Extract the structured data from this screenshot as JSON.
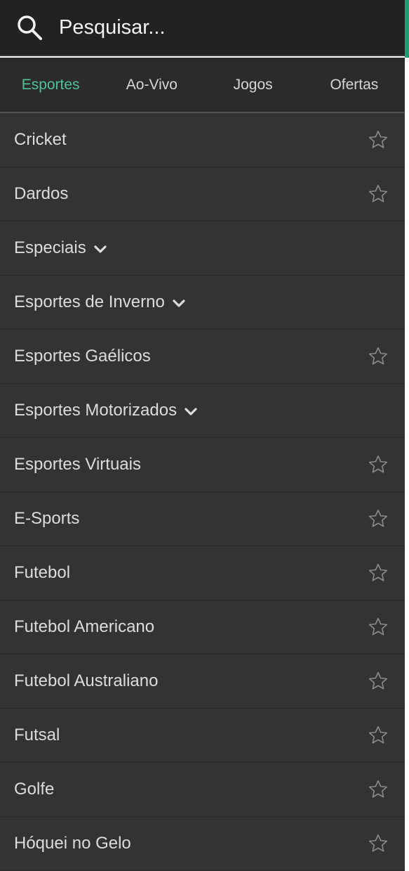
{
  "search": {
    "placeholder": "Pesquisar...",
    "icon": "search-icon"
  },
  "colors": {
    "accent": "#4fc295",
    "header_bg": "#222222",
    "list_bg": "#333333"
  },
  "tabs": [
    {
      "label": "Esportes",
      "active": true
    },
    {
      "label": "Ao-Vivo",
      "active": false
    },
    {
      "label": "Jogos",
      "active": false
    },
    {
      "label": "Ofertas",
      "active": false
    }
  ],
  "sports": [
    {
      "label": "Cricket",
      "action": "star"
    },
    {
      "label": "Dardos",
      "action": "star"
    },
    {
      "label": "Especiais",
      "action": "expand"
    },
    {
      "label": "Esportes de Inverno",
      "action": "expand"
    },
    {
      "label": "Esportes Gaélicos",
      "action": "star"
    },
    {
      "label": "Esportes Motorizados",
      "action": "expand"
    },
    {
      "label": "Esportes Virtuais",
      "action": "star"
    },
    {
      "label": "E-Sports",
      "action": "star"
    },
    {
      "label": "Futebol",
      "action": "star"
    },
    {
      "label": "Futebol Americano",
      "action": "star"
    },
    {
      "label": "Futebol Australiano",
      "action": "star"
    },
    {
      "label": "Futsal",
      "action": "star"
    },
    {
      "label": "Golfe",
      "action": "star"
    },
    {
      "label": "Hóquei no Gelo",
      "action": "star"
    }
  ]
}
